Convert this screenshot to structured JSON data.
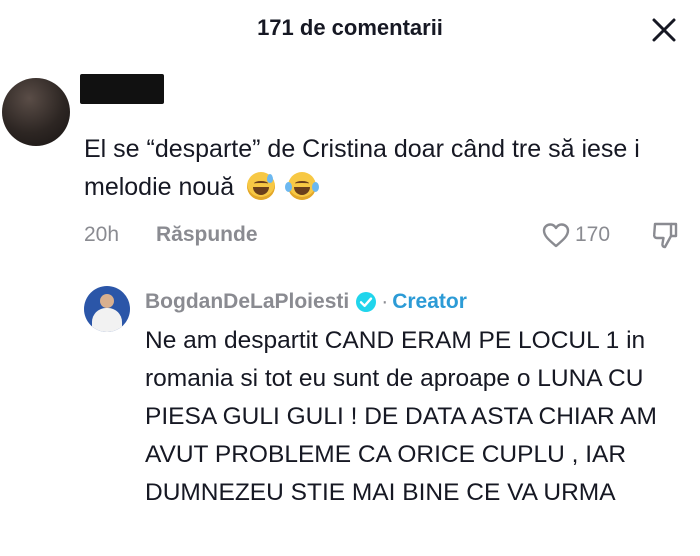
{
  "header": {
    "title": "171 de comentarii",
    "close_icon": "close-icon"
  },
  "comment": {
    "author_redacted": true,
    "text": "El se “desparte” de Cristina doar când tre să iese i melodie nouă",
    "emojis": [
      "grinning-sweat-emoji",
      "tears-of-joy-emoji"
    ],
    "time": "20h",
    "reply_label": "Răspunde",
    "like_count": "170",
    "like_icon": "heart-icon",
    "dislike_icon": "thumbs-down-icon"
  },
  "reply": {
    "author": "BogdanDeLaPloiesti",
    "verified_icon": "verified-badge-icon",
    "separator": "·",
    "badge": "Creator",
    "text": "Ne am despartit CAND ERAM PE LOCUL 1 in romania si tot eu sunt de aproape o LUNA CU PIESA GULI GULI ! DE DATA ASTA CHIAR AM AVUT PROBLEME CA ORICE CUPLU , IAR DUMNEZEU STIE MAI BINE CE VA URMA"
  },
  "colors": {
    "primary_text": "#161823",
    "secondary_text": "#8a8b91",
    "creator_accent": "#2c9bd6",
    "verified_badge": "#20d5ec"
  }
}
